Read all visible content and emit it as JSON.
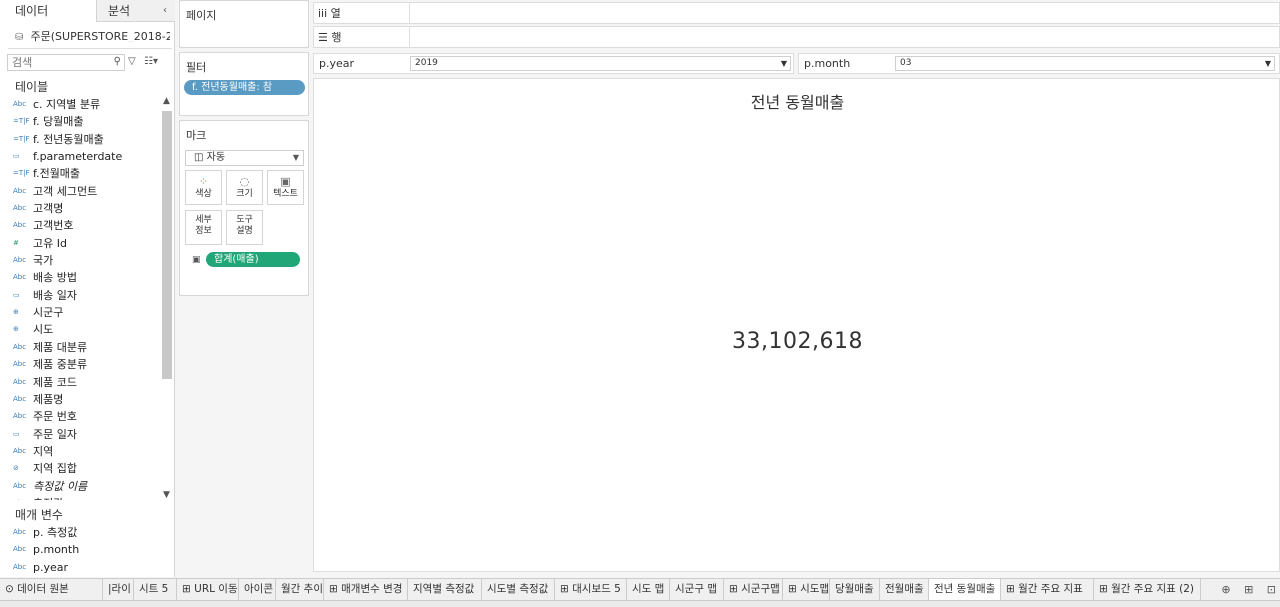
{
  "left_pane": {
    "tab_data": "데이터",
    "tab_analysis": "분석",
    "collapse_icon": "‹",
    "datasource": "주문(SUPERSTORE_2018-2...",
    "search_placeholder": "검색",
    "tables_title": "테이블",
    "fields": [
      {
        "type": "Abc",
        "label": "c. 지역별 분류"
      },
      {
        "type": "T|F",
        "label": "f. 당월매출"
      },
      {
        "type": "T|F",
        "label": "f. 전년동월매출"
      },
      {
        "type": "date",
        "label": "f.parameterdate"
      },
      {
        "type": "T|F",
        "label": "f.전월매출"
      },
      {
        "type": "Abc",
        "label": "고객 세그먼트"
      },
      {
        "type": "Abc",
        "label": "고객명"
      },
      {
        "type": "Abc",
        "label": "고객번호"
      },
      {
        "type": "#",
        "label": "고유 Id"
      },
      {
        "type": "Abc",
        "label": "국가"
      },
      {
        "type": "Abc",
        "label": "배송 방법"
      },
      {
        "type": "date",
        "label": "배송 일자"
      },
      {
        "type": "geo",
        "label": "시군구"
      },
      {
        "type": "geo",
        "label": "시도"
      },
      {
        "type": "Abc",
        "label": "제품 대분류"
      },
      {
        "type": "Abc",
        "label": "제품 중분류"
      },
      {
        "type": "Abc",
        "label": "제품 코드"
      },
      {
        "type": "Abc",
        "label": "제품명"
      },
      {
        "type": "Abc",
        "label": "주문 번호"
      },
      {
        "type": "date",
        "label": "주문 일자"
      },
      {
        "type": "Abc",
        "label": "지역"
      },
      {
        "type": "set",
        "label": "지역 집합"
      },
      {
        "type": "Abc",
        "label": "측정값 이름",
        "italic": true
      },
      {
        "type": "Abc",
        "label": "측정값"
      }
    ],
    "params_title": "매개 변수",
    "params": [
      {
        "type": "Abc",
        "label": "p. 측정값"
      },
      {
        "type": "Abc",
        "label": "p.month"
      },
      {
        "type": "Abc",
        "label": "p.year"
      }
    ]
  },
  "pages": {
    "title": "페이지"
  },
  "filters": {
    "title": "필터",
    "pill": "f. 전년동월매출: 참"
  },
  "marks": {
    "title": "마크",
    "type_value": "자동",
    "buttons": {
      "color": "색상",
      "size": "크기",
      "text": "텍스트",
      "detail": "세부\n정보",
      "tooltip": "도구\n설명"
    },
    "pill": "합계(매출)"
  },
  "shelves": {
    "columns": "열",
    "rows": "행"
  },
  "params_bar": {
    "year_label": "p.year",
    "year_value": "2019",
    "month_label": "p.month",
    "month_value": "03"
  },
  "view": {
    "title": "전년 동월매출",
    "value": "33,102,618"
  },
  "tabs": [
    {
      "label": "데이터 원본",
      "icon": "⊙"
    },
    {
      "label": "|라이"
    },
    {
      "label": "시트 5"
    },
    {
      "label": "URL 이동",
      "icon": "⊞"
    },
    {
      "label": "아이콘"
    },
    {
      "label": "월간 추이"
    },
    {
      "label": "매개변수 변경",
      "icon": "⊞"
    },
    {
      "label": "지역별 측정값"
    },
    {
      "label": "시도별 측정값"
    },
    {
      "label": "대시보드 5",
      "icon": "⊞"
    },
    {
      "label": "시도 맵"
    },
    {
      "label": "시군구 맵"
    },
    {
      "label": "시군구맵",
      "icon": "⊞"
    },
    {
      "label": "시도맵",
      "icon": "⊞"
    },
    {
      "label": "당월매출"
    },
    {
      "label": "전월매출"
    },
    {
      "label": "전년 동월매출",
      "active": true
    },
    {
      "label": "월간 주요 지표",
      "icon": "⊞"
    },
    {
      "label": "월간 주요 지표 (2)",
      "icon": "⊞"
    }
  ],
  "colors": {
    "filter_pill": "#5a9bc3",
    "measure_pill": "#21a777"
  }
}
